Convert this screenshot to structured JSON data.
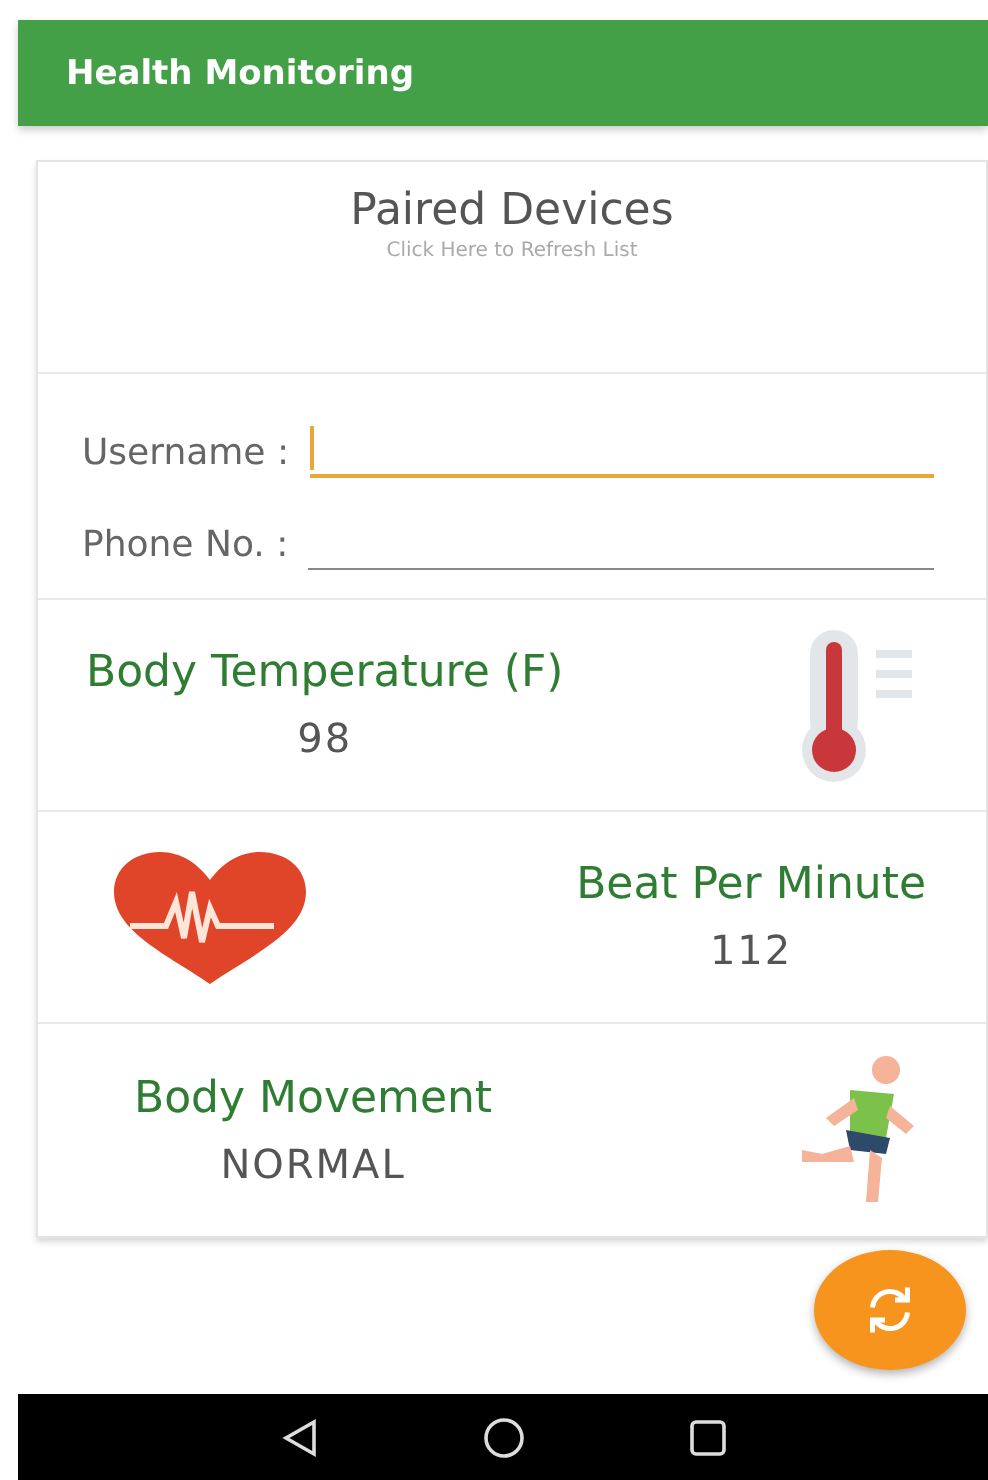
{
  "app_bar": {
    "title": "Health Monitoring"
  },
  "devices": {
    "title": "Paired Devices",
    "subtitle": "Click Here to Refresh List"
  },
  "fields": [
    {
      "label": "Username :",
      "focused": true
    },
    {
      "label": "Phone No. :",
      "focused": false
    }
  ],
  "metrics": [
    {
      "kind": "thermometer",
      "label": "Body Temperature (F)",
      "value": "98"
    },
    {
      "kind": "heart",
      "label": "Beat Per Minute",
      "value": "112"
    },
    {
      "kind": "runner",
      "label": "Body Movement",
      "value": "NORMAL"
    }
  ]
}
